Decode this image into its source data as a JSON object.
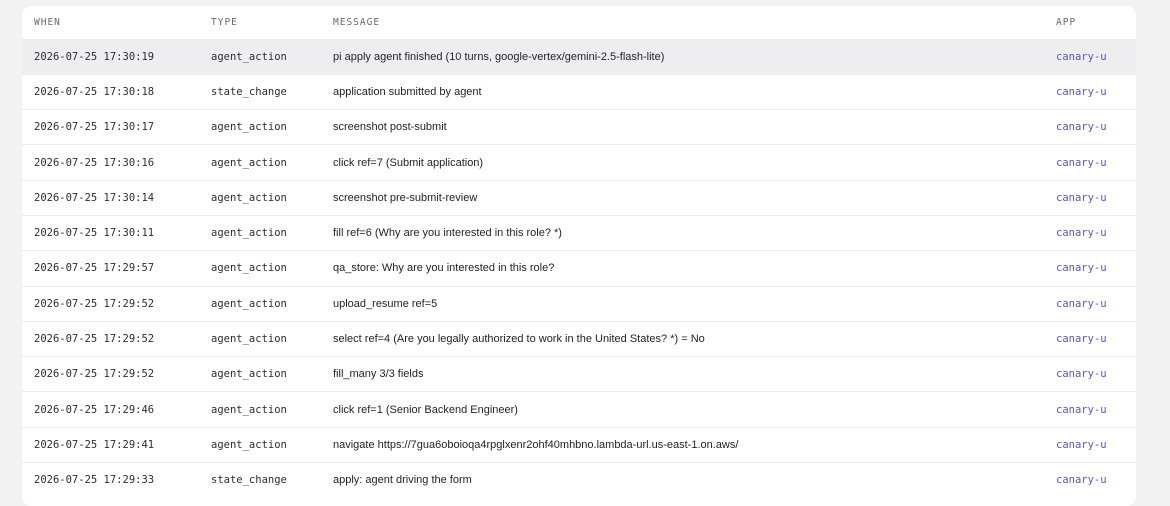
{
  "table": {
    "headers": {
      "when": "WHEN",
      "type": "TYPE",
      "message": "MESSAGE",
      "app": "APP"
    },
    "rows": [
      {
        "when": "2026-07-25 17:30:19",
        "type": "agent_action",
        "message": "pi apply agent finished (10 turns, google-vertex/gemini-2.5-flash-lite)",
        "app": "canary-u"
      },
      {
        "when": "2026-07-25 17:30:18",
        "type": "state_change",
        "message": "application submitted by agent",
        "app": "canary-u"
      },
      {
        "when": "2026-07-25 17:30:17",
        "type": "agent_action",
        "message": "screenshot post-submit",
        "app": "canary-u"
      },
      {
        "when": "2026-07-25 17:30:16",
        "type": "agent_action",
        "message": "click ref=7 (Submit application)",
        "app": "canary-u"
      },
      {
        "when": "2026-07-25 17:30:14",
        "type": "agent_action",
        "message": "screenshot pre-submit-review",
        "app": "canary-u"
      },
      {
        "when": "2026-07-25 17:30:11",
        "type": "agent_action",
        "message": "fill ref=6 (Why are you interested in this role? *)",
        "app": "canary-u"
      },
      {
        "when": "2026-07-25 17:29:57",
        "type": "agent_action",
        "message": "qa_store: Why are you interested in this role?",
        "app": "canary-u"
      },
      {
        "when": "2026-07-25 17:29:52",
        "type": "agent_action",
        "message": "upload_resume ref=5",
        "app": "canary-u"
      },
      {
        "when": "2026-07-25 17:29:52",
        "type": "agent_action",
        "message": "select ref=4 (Are you legally authorized to work in the United States? *) = No",
        "app": "canary-u"
      },
      {
        "when": "2026-07-25 17:29:52",
        "type": "agent_action",
        "message": "fill_many 3/3 fields",
        "app": "canary-u"
      },
      {
        "when": "2026-07-25 17:29:46",
        "type": "agent_action",
        "message": "click ref=1 (Senior Backend Engineer)",
        "app": "canary-u"
      },
      {
        "when": "2026-07-25 17:29:41",
        "type": "agent_action",
        "message": "navigate https://7gua6oboioqa4rpglxenr2ohf40mhbno.lambda-url.us-east-1.on.aws/",
        "app": "canary-u"
      },
      {
        "when": "2026-07-25 17:29:33",
        "type": "state_change",
        "message": "apply: agent driving the form",
        "app": "canary-u"
      }
    ]
  }
}
